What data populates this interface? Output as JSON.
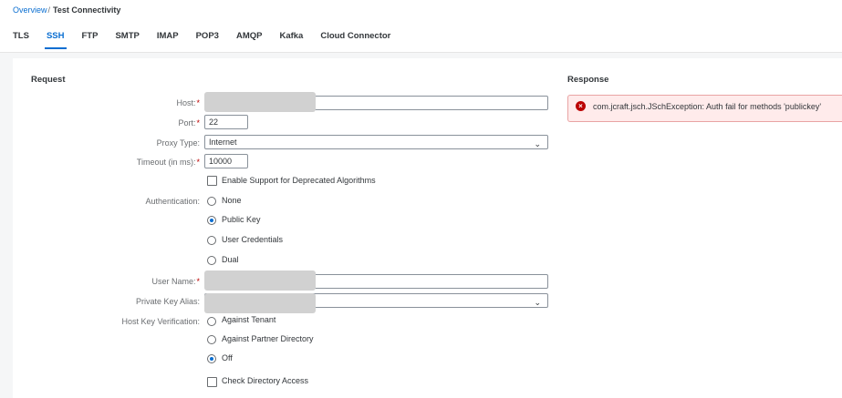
{
  "breadcrumb": {
    "overview": "Overview",
    "separator": "/",
    "current": "Test Connectivity"
  },
  "tabs": [
    {
      "label": "TLS"
    },
    {
      "label": "SSH"
    },
    {
      "label": "FTP"
    },
    {
      "label": "SMTP"
    },
    {
      "label": "IMAP"
    },
    {
      "label": "POP3"
    },
    {
      "label": "AMQP"
    },
    {
      "label": "Kafka"
    },
    {
      "label": "Cloud Connector"
    }
  ],
  "active_tab": "SSH",
  "request": {
    "title": "Request",
    "host_label": "Host:",
    "port_label": "Port:",
    "port_value": "22",
    "proxy_label": "Proxy Type:",
    "proxy_value": "Internet",
    "timeout_label": "Timeout (in ms):",
    "timeout_value": "10000",
    "deprecated_label": "Enable Support for Deprecated Algorithms",
    "auth_label": "Authentication:",
    "auth_options": [
      "None",
      "Public Key",
      "User Credentials",
      "Dual"
    ],
    "auth_selected": "Public Key",
    "username_label": "User Name:",
    "pkalias_label": "Private Key Alias:",
    "hostkey_label": "Host Key Verification:",
    "hostkey_options": [
      "Against Tenant",
      "Against Partner Directory",
      "Off"
    ],
    "hostkey_selected": "Off",
    "check_dir_label": "Check Directory Access",
    "required_mark": "*"
  },
  "response": {
    "title": "Response",
    "error_text": "com.jcraft.jsch.JSchException: Auth fail for methods 'publickey'"
  }
}
